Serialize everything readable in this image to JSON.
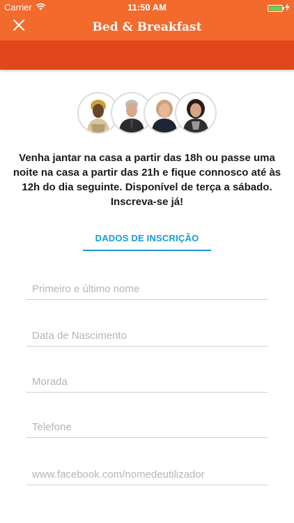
{
  "status": {
    "carrier": "Carrier",
    "time": "11:50 AM"
  },
  "header": {
    "title": "Bed & Breakfast"
  },
  "intro": {
    "text": "Venha jantar na casa a partir das 18h ou passe uma noite na casa a partir das 21h e fique connosco até às 12h do dia seguinte. Disponível de terça a sábado. Inscreva-se já!"
  },
  "form": {
    "section_title": "DADOS DE INSCRIÇÃO",
    "name_placeholder": "Primeiro e último nome",
    "birthdate_placeholder": "Data de Nascimento",
    "address_placeholder": "Morada",
    "phone_placeholder": "Telefone",
    "facebook_placeholder": "www.facebook.com/nomedeutilizador"
  },
  "colors": {
    "header": "#f26a2c",
    "subbar": "#e0481c",
    "accent": "#1a9ad6"
  }
}
